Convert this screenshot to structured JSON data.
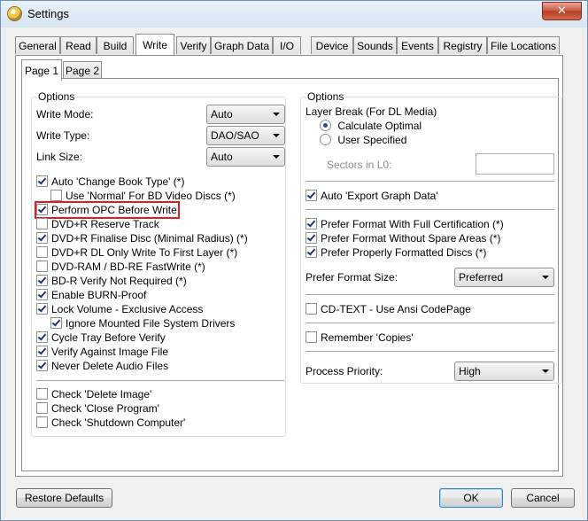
{
  "window": {
    "title": "Settings",
    "close_label": "✕"
  },
  "tabs": [
    "General",
    "Read",
    "Build",
    "Write",
    "Verify",
    "Graph Data",
    "I/O",
    "Device",
    "Sounds",
    "Events",
    "Registry",
    "File Locations"
  ],
  "active_tab": "Write",
  "subtabs": [
    "Page 1",
    "Page 2"
  ],
  "left": {
    "group_title": "Options",
    "write_mode_label": "Write Mode:",
    "write_mode_value": "Auto",
    "write_type_label": "Write Type:",
    "write_type_value": "DAO/SAO",
    "link_size_label": "Link Size:",
    "link_size_value": "Auto",
    "checks": [
      {
        "label": "Auto 'Change Book Type' (*)",
        "checked": true
      },
      {
        "label": "Use 'Normal' For BD Video Discs (*)",
        "checked": false
      },
      {
        "label": "Perform OPC Before Write",
        "checked": true
      },
      {
        "label": "DVD+R Reserve Track",
        "checked": false
      },
      {
        "label": "DVD+R Finalise Disc (Minimal Radius) (*)",
        "checked": true
      },
      {
        "label": "DVD+R DL Only Write To First Layer (*)",
        "checked": false
      },
      {
        "label": "DVD-RAM / BD-RE FastWrite (*)",
        "checked": false
      },
      {
        "label": "BD-R Verify Not Required (*)",
        "checked": true
      },
      {
        "label": "Enable BURN-Proof",
        "checked": true
      },
      {
        "label": "Lock Volume - Exclusive Access",
        "checked": true
      },
      {
        "label": "Ignore Mounted File System Drivers",
        "checked": true
      },
      {
        "label": "Cycle Tray Before Verify",
        "checked": true
      },
      {
        "label": "Verify Against Image File",
        "checked": true
      },
      {
        "label": "Never Delete Audio Files",
        "checked": true
      },
      {
        "label": "Check 'Delete Image'",
        "checked": false
      },
      {
        "label": "Check 'Close Program'",
        "checked": false
      },
      {
        "label": "Check 'Shutdown Computer'",
        "checked": false
      }
    ]
  },
  "right": {
    "group_title": "Options",
    "layer_break_label": "Layer Break (For DL Media)",
    "radio_optimal": "Calculate Optimal",
    "radio_user": "User Specified",
    "sectors_label": "Sectors in L0:",
    "sectors_value": "",
    "auto_export_label": "Auto 'Export Graph Data'",
    "prefer_full_cert": "Prefer Format With Full Certification (*)",
    "prefer_no_spare": "Prefer Format Without Spare Areas (*)",
    "prefer_proper": "Prefer Properly Formatted Discs (*)",
    "prefer_size_label": "Prefer Format Size:",
    "prefer_size_value": "Preferred",
    "cdtext_label": "CD-TEXT - Use Ansi CodePage",
    "remember_copies_label": "Remember 'Copies'",
    "priority_label": "Process Priority:",
    "priority_value": "High"
  },
  "buttons": {
    "restore": "Restore Defaults",
    "ok": "OK",
    "cancel": "Cancel"
  },
  "colors": {
    "highlight": "#e21c1c",
    "title_bg": "#dce7f4"
  }
}
